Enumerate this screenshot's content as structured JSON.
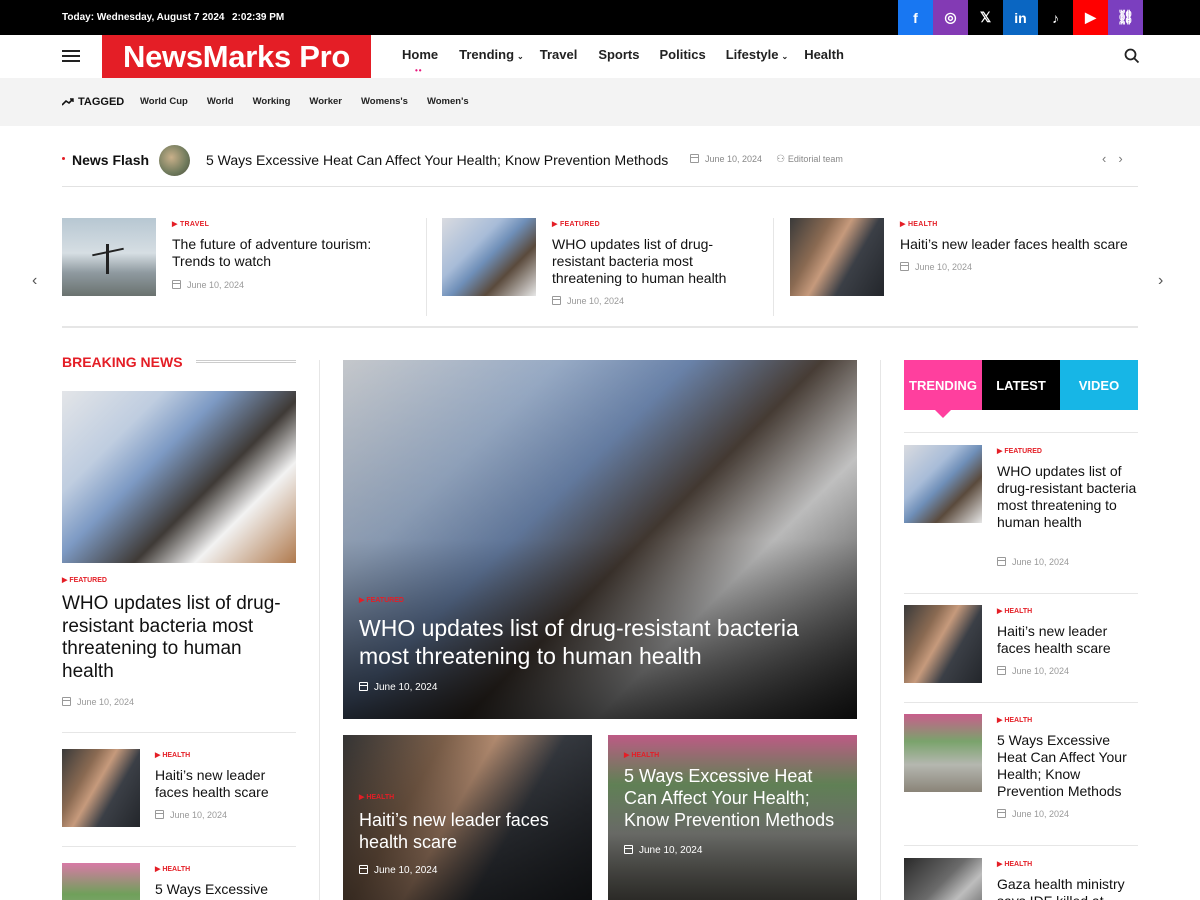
{
  "topbar": {
    "date": "Today: Wednesday, August 7 2024",
    "time": "2:02:39 PM"
  },
  "social": [
    {
      "name": "facebook-icon",
      "glyph": "f",
      "color": "#1877f2"
    },
    {
      "name": "instagram-icon",
      "glyph": "◎",
      "color": "#833ab4"
    },
    {
      "name": "x-icon",
      "glyph": "𝕏",
      "color": "#000000"
    },
    {
      "name": "linkedin-icon",
      "glyph": "in",
      "color": "#0a66c2"
    },
    {
      "name": "tiktok-icon",
      "glyph": "♪",
      "color": "#000000"
    },
    {
      "name": "youtube-icon",
      "glyph": "▶",
      "color": "#ff0000"
    },
    {
      "name": "link-icon",
      "glyph": "⛓",
      "color": "#7b3fbf"
    }
  ],
  "header": {
    "logo": "NewsMarks Pro"
  },
  "nav": [
    {
      "label": "Home",
      "dropdown": false,
      "active": true
    },
    {
      "label": "Trending",
      "dropdown": true
    },
    {
      "label": "Travel",
      "dropdown": false
    },
    {
      "label": "Sports",
      "dropdown": false
    },
    {
      "label": "Politics",
      "dropdown": false
    },
    {
      "label": "Lifestyle",
      "dropdown": true
    },
    {
      "label": "Health",
      "dropdown": false
    }
  ],
  "tagbar": {
    "label": "TAGGED",
    "tags": [
      "World Cup",
      "World",
      "Working",
      "Worker",
      "Womens's",
      "Women's"
    ]
  },
  "newsflash": {
    "label": "News Flash",
    "headline": "5 Ways Excessive Heat Can Affect Your Health; Know Prevention Methods",
    "date": "June 10, 2024",
    "author": "Editorial team"
  },
  "carousel": [
    {
      "category": "TRAVEL",
      "title": "The future of adventure tourism: Trends to watch",
      "date": "June 10, 2024"
    },
    {
      "category": "FEATURED",
      "title": "WHO updates list of drug-resistant bacteria most threatening to human health",
      "date": "June 10, 2024"
    },
    {
      "category": "HEALTH",
      "title": "Haiti’s new leader faces health scare",
      "date": "June 10, 2024"
    }
  ],
  "breaking": {
    "section_title": "BREAKING NEWS",
    "main": {
      "category": "FEATURED",
      "title": "WHO updates list of drug-resistant bacteria most threatening to human health",
      "date": "June 10, 2024"
    },
    "items": [
      {
        "category": "HEALTH",
        "title": "Haiti’s new leader faces health scare",
        "date": "June 10, 2024"
      },
      {
        "category": "HEALTH",
        "title": "5 Ways Excessive",
        "date": ""
      }
    ]
  },
  "hero": {
    "category": "FEATURED",
    "title": "WHO updates list of drug-resistant bacteria most threatening to human health",
    "date": "June 10, 2024"
  },
  "sub_cards": [
    {
      "category": "HEALTH",
      "title": "Haiti’s new leader faces health scare",
      "date": "June 10, 2024"
    },
    {
      "category": "HEALTH",
      "title": "5 Ways Excessive Heat Can Affect Your Health; Know Prevention Methods",
      "date": "June 10, 2024"
    }
  ],
  "tabs": [
    {
      "label": "TRENDING",
      "color": "#ff3f9e"
    },
    {
      "label": "LATEST",
      "color": "#000000"
    },
    {
      "label": "VIDEO",
      "color": "#17b6e6"
    }
  ],
  "sidebar": [
    {
      "category": "FEATURED",
      "title": "WHO updates list of drug-resistant bacteria most threatening to human health",
      "date": "June 10, 2024"
    },
    {
      "category": "HEALTH",
      "title": "Haiti’s new leader faces health scare",
      "date": "June 10, 2024"
    },
    {
      "category": "HEALTH",
      "title": "5 Ways Excessive Heat Can Affect Your Health; Know Prevention Methods",
      "date": "June 10, 2024"
    },
    {
      "category": "HEALTH",
      "title": "Gaza health ministry says IDF killed at least",
      "date": ""
    }
  ]
}
